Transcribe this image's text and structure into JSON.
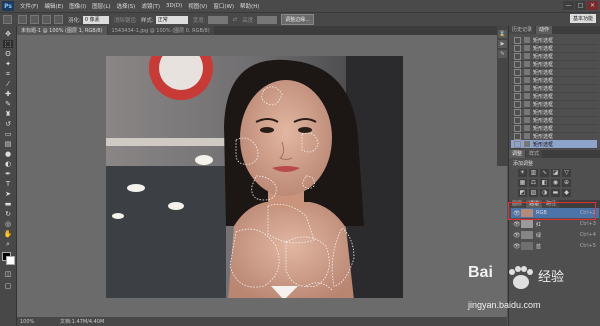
{
  "menubar": {
    "logo": "Ps",
    "items": [
      "文件(F)",
      "编辑(E)",
      "图像(I)",
      "图层(L)",
      "选择(S)",
      "滤镜(T)",
      "3D(D)",
      "视图(V)",
      "窗口(W)",
      "帮助(H)"
    ],
    "win_min": "—",
    "win_max": "□",
    "win_close": "✕"
  },
  "options": {
    "feather_label": "羽化:",
    "feather_value": "0 像素",
    "antialias_label": "消除锯齿",
    "style_label": "样式:",
    "style_value": "正常",
    "width_label": "宽度:",
    "height_label": "高度:",
    "refine_button": "调整边缘...",
    "workspace": "基本功能"
  },
  "tabs": [
    {
      "label": "未标题-1 @ 100% (图层 1, RGB/8)",
      "active": true
    },
    {
      "label": "1543434-1.jpg @ 100% (图层 0, RGB/8)",
      "active": false
    }
  ],
  "status": {
    "zoom": "100%",
    "doc": "文档:1.47M/4.40M"
  },
  "history_panel": {
    "tabs": [
      "历史记录",
      "动作"
    ],
    "rows": [
      "矩形选框",
      "矩形选框",
      "矩形选框",
      "矩形选框",
      "矩形选框",
      "矩形选框",
      "矩形选框",
      "矩形选框",
      "矩形选框",
      "矩形选框",
      "矩形选框",
      "矩形选框",
      "矩形选框",
      "矩形选框"
    ]
  },
  "adjust_panel": {
    "tabs": [
      "调整",
      "样式"
    ],
    "title": "添加调整"
  },
  "layers_panel": {
    "tabs": [
      "图层",
      "通道",
      "路径"
    ],
    "layers": [
      {
        "name": "RGB",
        "shortcut": "Ctrl+2",
        "selected": true
      },
      {
        "name": "红",
        "shortcut": "Ctrl+3",
        "selected": false
      },
      {
        "name": "绿",
        "shortcut": "Ctrl+4",
        "selected": false
      },
      {
        "name": "蓝",
        "shortcut": "Ctrl+5",
        "selected": false
      }
    ]
  },
  "watermark": {
    "brand": "Bai",
    "brand2": "经验",
    "url": "jingyan.baidu.com"
  },
  "colors": {
    "selection_highlight": "#e03030",
    "selected_layer": "#4d74a8",
    "history_selected": "#8ea3c9"
  }
}
